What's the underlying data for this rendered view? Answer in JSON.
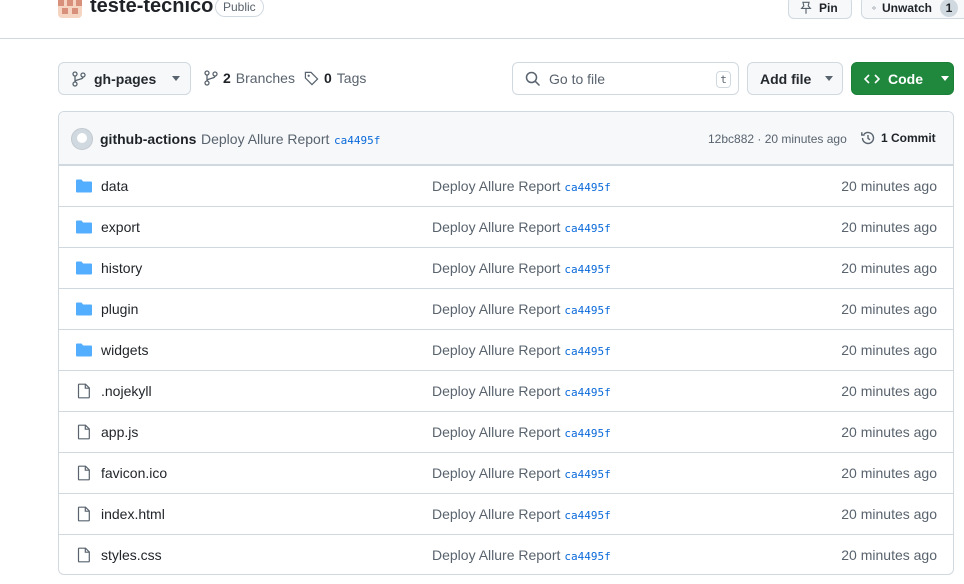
{
  "repo": {
    "name": "teste-tecnico",
    "visibility": "Public",
    "pin_label": "Pin",
    "watch_label": "Unwatch",
    "watch_count": "1"
  },
  "toolbar": {
    "branch": "gh-pages",
    "branches_count": "2",
    "branches_label": "Branches",
    "tags_count": "0",
    "tags_label": "Tags",
    "search_placeholder": "Go to file",
    "search_shortcut": "t",
    "add_file_label": "Add file",
    "code_label": "Code"
  },
  "latest_commit": {
    "author": "github-actions",
    "message": "Deploy Allure Report",
    "sha": "ca4495f",
    "meta": "12bc882 · 20 minutes ago",
    "commits_label": "1 Commit"
  },
  "files": [
    {
      "name": "data",
      "type": "dir",
      "message": "Deploy Allure Report",
      "sha": "ca4495f",
      "time": "20 minutes ago"
    },
    {
      "name": "export",
      "type": "dir",
      "message": "Deploy Allure Report",
      "sha": "ca4495f",
      "time": "20 minutes ago"
    },
    {
      "name": "history",
      "type": "dir",
      "message": "Deploy Allure Report",
      "sha": "ca4495f",
      "time": "20 minutes ago"
    },
    {
      "name": "plugin",
      "type": "dir",
      "message": "Deploy Allure Report",
      "sha": "ca4495f",
      "time": "20 minutes ago"
    },
    {
      "name": "widgets",
      "type": "dir",
      "message": "Deploy Allure Report",
      "sha": "ca4495f",
      "time": "20 minutes ago"
    },
    {
      "name": ".nojekyll",
      "type": "file",
      "message": "Deploy Allure Report",
      "sha": "ca4495f",
      "time": "20 minutes ago"
    },
    {
      "name": "app.js",
      "type": "file",
      "message": "Deploy Allure Report",
      "sha": "ca4495f",
      "time": "20 minutes ago"
    },
    {
      "name": "favicon.ico",
      "type": "file",
      "message": "Deploy Allure Report",
      "sha": "ca4495f",
      "time": "20 minutes ago"
    },
    {
      "name": "index.html",
      "type": "file",
      "message": "Deploy Allure Report",
      "sha": "ca4495f",
      "time": "20 minutes ago"
    },
    {
      "name": "styles.css",
      "type": "file",
      "message": "Deploy Allure Report",
      "sha": "ca4495f",
      "time": "20 minutes ago"
    }
  ],
  "colors": {
    "accent_blue": "#0969da",
    "folder": "#54aeff",
    "code_button": "#1f883d",
    "border": "#d1d9e0"
  }
}
